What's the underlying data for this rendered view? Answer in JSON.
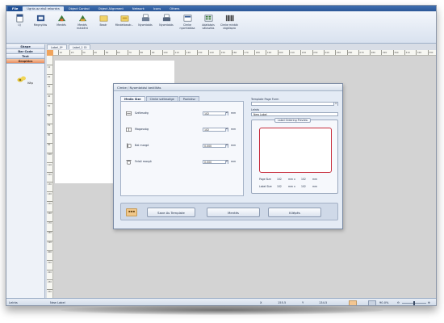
{
  "menu": {
    "file": "File",
    "tabs": [
      "Ugrás az első rekordra",
      "Object Control",
      "Object Alignment",
      "Network",
      "Icons",
      "Others"
    ],
    "active_index": 0
  },
  "ribbon": {
    "buttons": [
      {
        "label": "Új",
        "icon": "new-document-icon"
      },
      {
        "label": "Megnyitás",
        "icon": "open-folder-icon"
      },
      {
        "label": "Mentés",
        "icon": "save-icon"
      },
      {
        "label": "Mentés másként",
        "icon": "save-as-icon"
      },
      {
        "label": "Bezár",
        "icon": "close-doc-icon"
      },
      {
        "label": "Mindetbezár...",
        "icon": "close-all-icon"
      },
      {
        "label": "Nyomtatás",
        "icon": "print-icon"
      },
      {
        "label": "Nyomtatás",
        "icon": "print-preview-icon"
      },
      {
        "label": "Címke nyomtatása",
        "icon": "label-print-icon"
      },
      {
        "label": "Adatbázis választás",
        "icon": "database-icon"
      },
      {
        "label": "Címke minták vágólapra",
        "icon": "barcode-icon"
      }
    ]
  },
  "left_panel": {
    "tabs": [
      "Shape",
      "Bar Code",
      "Text",
      "Graphics"
    ],
    "selected_tab": "Graphics",
    "item_label": "Kép"
  },
  "doc_tabs": [
    "Label_0*",
    "Label_1 Ol"
  ],
  "ruler": {
    "h_marks": [
      "10",
      "20",
      "30",
      "40",
      "50",
      "60",
      "70",
      "80",
      "90",
      "100",
      "110",
      "120",
      "130",
      "140",
      "150",
      "160",
      "170",
      "180",
      "190",
      "200",
      "210",
      "220",
      "230",
      "240",
      "250",
      "260",
      "270",
      "280",
      "290",
      "300",
      "310",
      "320",
      "330"
    ],
    "v_marks": [
      "10",
      "20",
      "30",
      "40",
      "50",
      "60",
      "70",
      "80",
      "90",
      "100",
      "110",
      "120",
      "130",
      "140",
      "150",
      "160",
      "170",
      "180",
      "190",
      "200",
      "210",
      "220",
      "230",
      "240"
    ]
  },
  "dialog": {
    "title": "Címke / Nyomtatási beállítás",
    "tabs": [
      "Media Size",
      "Címke szélessége",
      "Pozíciósz"
    ],
    "fields": [
      {
        "label": "Szélesség",
        "value": "102",
        "unit": "mm"
      },
      {
        "label": "Magasság",
        "value": "102",
        "unit": "mm"
      },
      {
        "label": "Bal margó",
        "value": "0.000",
        "unit": "mm"
      },
      {
        "label": "Felső margó",
        "value": "0.000",
        "unit": "mm"
      }
    ],
    "template_form_label": "Template Page Form",
    "template_form_value": "",
    "name_label": "Leírás",
    "name_value": "New Label",
    "preview_legend": "Label Ordering Preview",
    "page_size": {
      "label": "Page Size",
      "w": "102",
      "x": "mm  x",
      "h": "102",
      "unit": "mm"
    },
    "label_size": {
      "label": "Label Size",
      "w": "102",
      "x": "mm  x",
      "h": "102",
      "unit": "mm"
    },
    "color_button": "▪▪▪",
    "buttons": {
      "template": "Save As Template",
      "save": "Mentés",
      "exit": "Kilépés"
    }
  },
  "status": {
    "field": "Leírás",
    "value": "New Label",
    "x_label": "X",
    "x_value": "155.5",
    "y_label": "Y",
    "y_value": "134.5",
    "zoom": "90.0%"
  },
  "colors": {
    "accent": "#2b5797",
    "selected_tab": "#e98f63",
    "preview_border": "#c72c3c"
  }
}
